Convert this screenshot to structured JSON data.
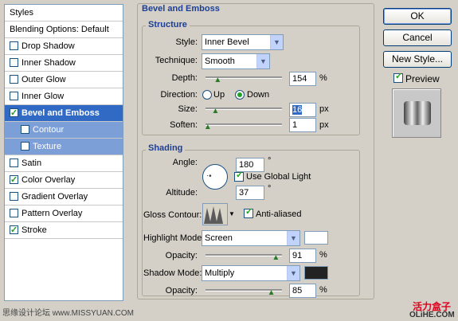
{
  "styles_panel": {
    "header": "Styles",
    "items": [
      {
        "label": "Blending Options: Default",
        "checkbox": false,
        "checked": false
      },
      {
        "label": "Drop Shadow",
        "checkbox": true,
        "checked": false
      },
      {
        "label": "Inner Shadow",
        "checkbox": true,
        "checked": false
      },
      {
        "label": "Outer Glow",
        "checkbox": true,
        "checked": false
      },
      {
        "label": "Inner Glow",
        "checkbox": true,
        "checked": false
      },
      {
        "label": "Bevel and Emboss",
        "checkbox": true,
        "checked": true
      },
      {
        "label": "Contour",
        "checkbox": true,
        "checked": false
      },
      {
        "label": "Texture",
        "checkbox": true,
        "checked": false
      },
      {
        "label": "Satin",
        "checkbox": true,
        "checked": false
      },
      {
        "label": "Color Overlay",
        "checkbox": true,
        "checked": true
      },
      {
        "label": "Gradient Overlay",
        "checkbox": true,
        "checked": false
      },
      {
        "label": "Pattern Overlay",
        "checkbox": true,
        "checked": false
      },
      {
        "label": "Stroke",
        "checkbox": true,
        "checked": true
      }
    ]
  },
  "bevel": {
    "title": "Bevel and Emboss",
    "structure": {
      "legend": "Structure",
      "style_label": "Style:",
      "style_value": "Inner Bevel",
      "technique_label": "Technique:",
      "technique_value": "Smooth",
      "depth_label": "Depth:",
      "depth_value": "154",
      "depth_unit": "%",
      "depth_slider": 0.15,
      "direction_label": "Direction:",
      "dir_up": "Up",
      "dir_down": "Down",
      "direction_selected": "Down",
      "size_label": "Size:",
      "size_value": "16",
      "size_unit": "px",
      "size_slider": 0.12,
      "soften_label": "Soften:",
      "soften_value": "1",
      "soften_unit": "px",
      "soften_slider": 0.02
    },
    "shading": {
      "legend": "Shading",
      "angle_label": "Angle:",
      "angle_value": "180",
      "angle_unit": "°",
      "global_light_label": "Use Global Light",
      "altitude_label": "Altitude:",
      "altitude_value": "37",
      "altitude_unit": "°",
      "gloss_label": "Gloss Contour:",
      "anti_aliased_label": "Anti-aliased",
      "highlight_mode_label": "Highlight Mode:",
      "highlight_mode_value": "Screen",
      "highlight_color": "#ffffff",
      "highlight_opacity_label": "Opacity:",
      "highlight_opacity_value": "91",
      "highlight_opacity_unit": "%",
      "highlight_slider": 0.91,
      "shadow_mode_label": "Shadow Mode:",
      "shadow_mode_value": "Multiply",
      "shadow_color": "#222222",
      "shadow_opacity_label": "Opacity:",
      "shadow_opacity_value": "85",
      "shadow_opacity_unit": "%",
      "shadow_slider": 0.85
    }
  },
  "buttons": {
    "ok": "OK",
    "cancel": "Cancel",
    "new_style": "New Style...",
    "preview": "Preview"
  },
  "watermark": {
    "left": "思缘设计论坛 www.MISSYUAN.COM",
    "right_top": "活力盒子",
    "right_bottom": "OLiHE.COM"
  }
}
